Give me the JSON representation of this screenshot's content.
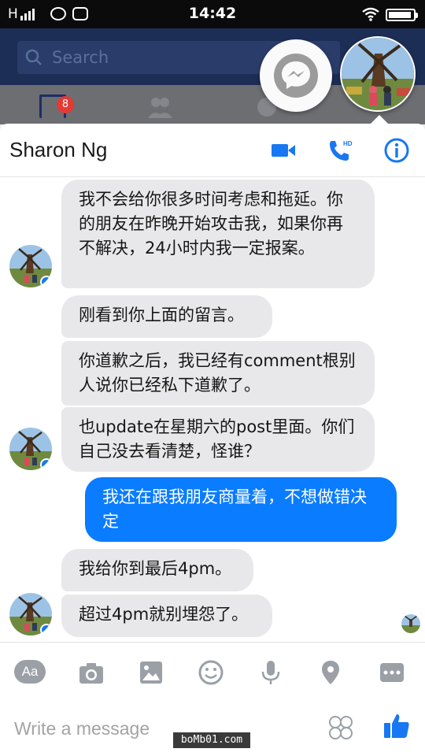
{
  "status_bar": {
    "carrier": "H",
    "time": "14:42",
    "battery_level": 0.92
  },
  "facebook": {
    "search_placeholder": "Search",
    "news_badge": "8"
  },
  "chat": {
    "contact_name": "Sharon Ng",
    "header_icons": [
      "video-call-icon",
      "hd-voice-call-icon",
      "info-icon"
    ],
    "messages": [
      {
        "from": "them",
        "text": "我不会给你很多时间考虑和拖延。你的朋友在昨晚开始攻击我，如果你再不解决，24小时内我一定报案。"
      },
      {
        "from": "them",
        "text": "刚看到你上面的留言。"
      },
      {
        "from": "them",
        "text": "你道歉之后，我已经有comment根别人说你已经私下道歉了。"
      },
      {
        "from": "them",
        "text": "也update在星期六的post里面。你们自己没去看清楚，怪谁？"
      },
      {
        "from": "me",
        "text": "我还在跟我朋友商量着，不想做错决定"
      },
      {
        "from": "them",
        "text": "我给你到最后4pm。"
      },
      {
        "from": "them",
        "text": "超过4pm就别埋怨了。"
      }
    ],
    "composer": {
      "aa_label": "Aa",
      "placeholder": "Write a message",
      "toolbar_icons": [
        "camera-icon",
        "gallery-icon",
        "emoji-icon",
        "microphone-icon",
        "location-icon",
        "more-icon"
      ]
    },
    "colors": {
      "outgoing_bubble": "#0a7cff",
      "incoming_bubble": "#e8e8ea",
      "accent": "#1877f2"
    }
  },
  "watermark": "boMb01.com"
}
